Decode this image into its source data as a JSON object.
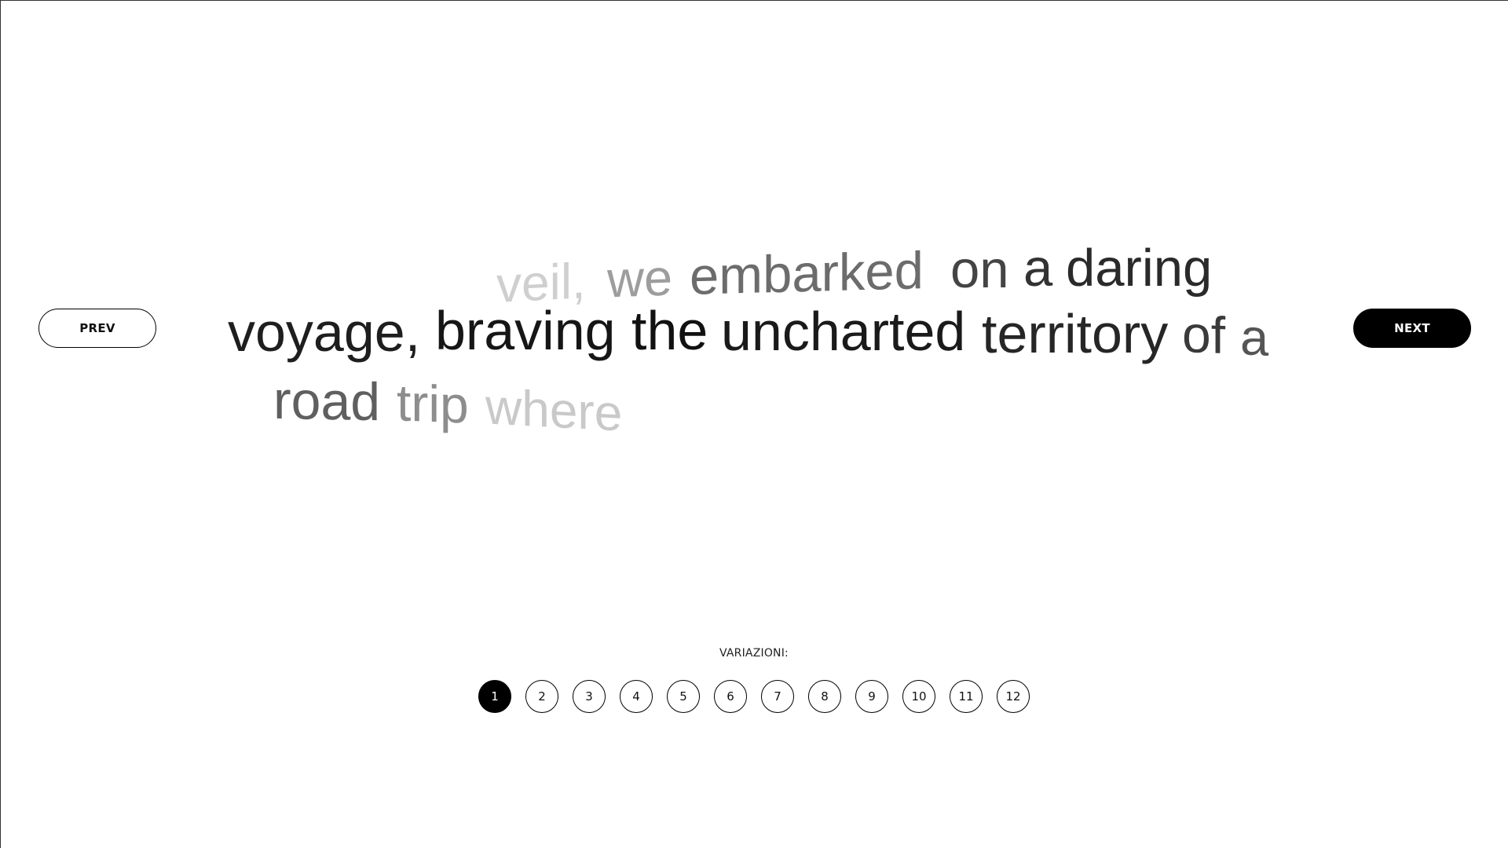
{
  "nav": {
    "prev_label": "PREV",
    "next_label": "NEXT"
  },
  "text_lines": [
    [
      "veil,",
      "we",
      "embarked",
      "on",
      "a",
      "daring"
    ],
    [
      "voyage,",
      "braving",
      "the",
      "uncharted",
      "territory",
      "of",
      "a"
    ],
    [
      "road",
      "trip",
      "where"
    ]
  ],
  "variations": {
    "label": "VARIAZIONI:",
    "options": [
      "1",
      "2",
      "3",
      "4",
      "5",
      "6",
      "7",
      "8",
      "9",
      "10",
      "11",
      "12"
    ],
    "selected": "1"
  },
  "colors": {
    "accent": "#000000",
    "background": "#ffffff"
  }
}
